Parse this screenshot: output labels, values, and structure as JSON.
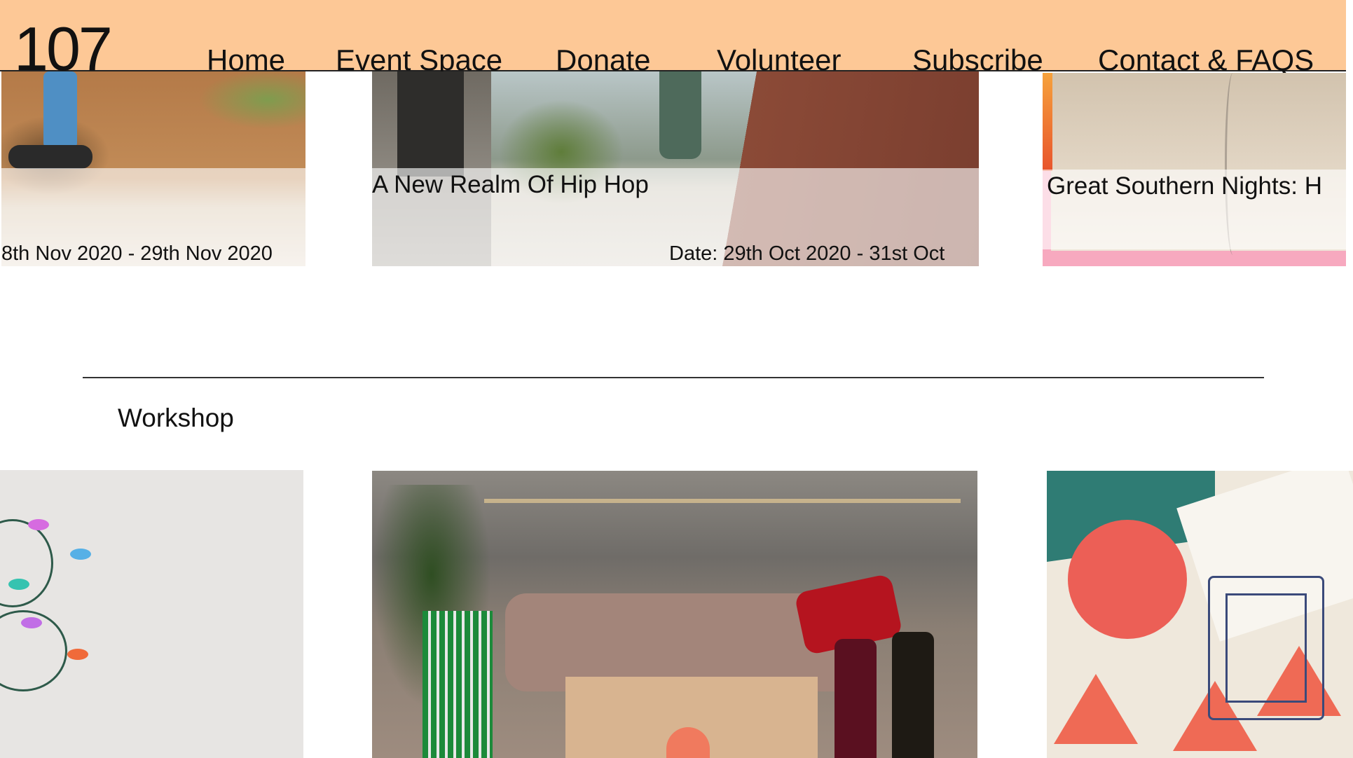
{
  "header": {
    "logo": "107",
    "nav": [
      "Home",
      "Event Space",
      "Donate",
      "Volunteer",
      "Subscribe",
      "Contact & FAQS"
    ]
  },
  "events": [
    {
      "title": "",
      "date": "8th Nov 2020 - 29th Nov 2020"
    },
    {
      "title": "A New Realm Of Hip Hop",
      "date": "Date: 29th Oct 2020 - 31st Oct"
    },
    {
      "title": "Great Southern Nights: H",
      "date": ""
    }
  ],
  "section": {
    "title": "Workshop"
  },
  "colors": {
    "header_bg": "#fdc896",
    "card3_border": "#f7a9bf",
    "text": "#111111"
  }
}
